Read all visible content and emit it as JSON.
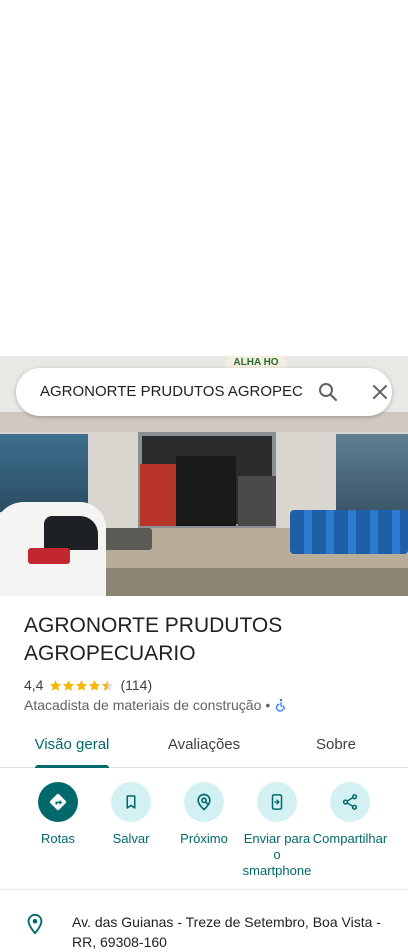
{
  "search": {
    "query": "AGRONORTE PRUDUTOS AGROPEC",
    "search_icon": "search-icon",
    "close_icon": "close-icon"
  },
  "photo": {
    "sign_text": "ALHA HO"
  },
  "place": {
    "name": "AGRONORTE PRUDUTOS AGROPECUARIO",
    "rating": "4,4",
    "stars": 4.4,
    "review_count": "(114)",
    "category": "Atacadista de materiais de construção",
    "separator": "•",
    "accessibility_icon": "wheelchair-icon"
  },
  "tabs": [
    {
      "label": "Visão geral",
      "active": true
    },
    {
      "label": "Avaliações",
      "active": false
    },
    {
      "label": "Sobre",
      "active": false
    }
  ],
  "actions": [
    {
      "label": "Rotas",
      "icon": "directions-icon"
    },
    {
      "label": "Salvar",
      "icon": "bookmark-icon"
    },
    {
      "label": "Próximo",
      "icon": "nearby-icon"
    },
    {
      "label": "Enviar para o smartphone",
      "icon": "send-to-phone-icon"
    },
    {
      "label": "Compartilhar",
      "icon": "share-icon"
    }
  ],
  "address": {
    "text": "Av. das Guianas - Treze de Setembro, Boa Vista - RR, 69308-160",
    "icon": "location-pin-icon"
  },
  "colors": {
    "accent": "#00696c",
    "accent_light": "#d3f1f3",
    "star": "#f6b400",
    "text": "#202124",
    "secondary_text": "#5f6368",
    "accessibility": "#1a73e8"
  }
}
